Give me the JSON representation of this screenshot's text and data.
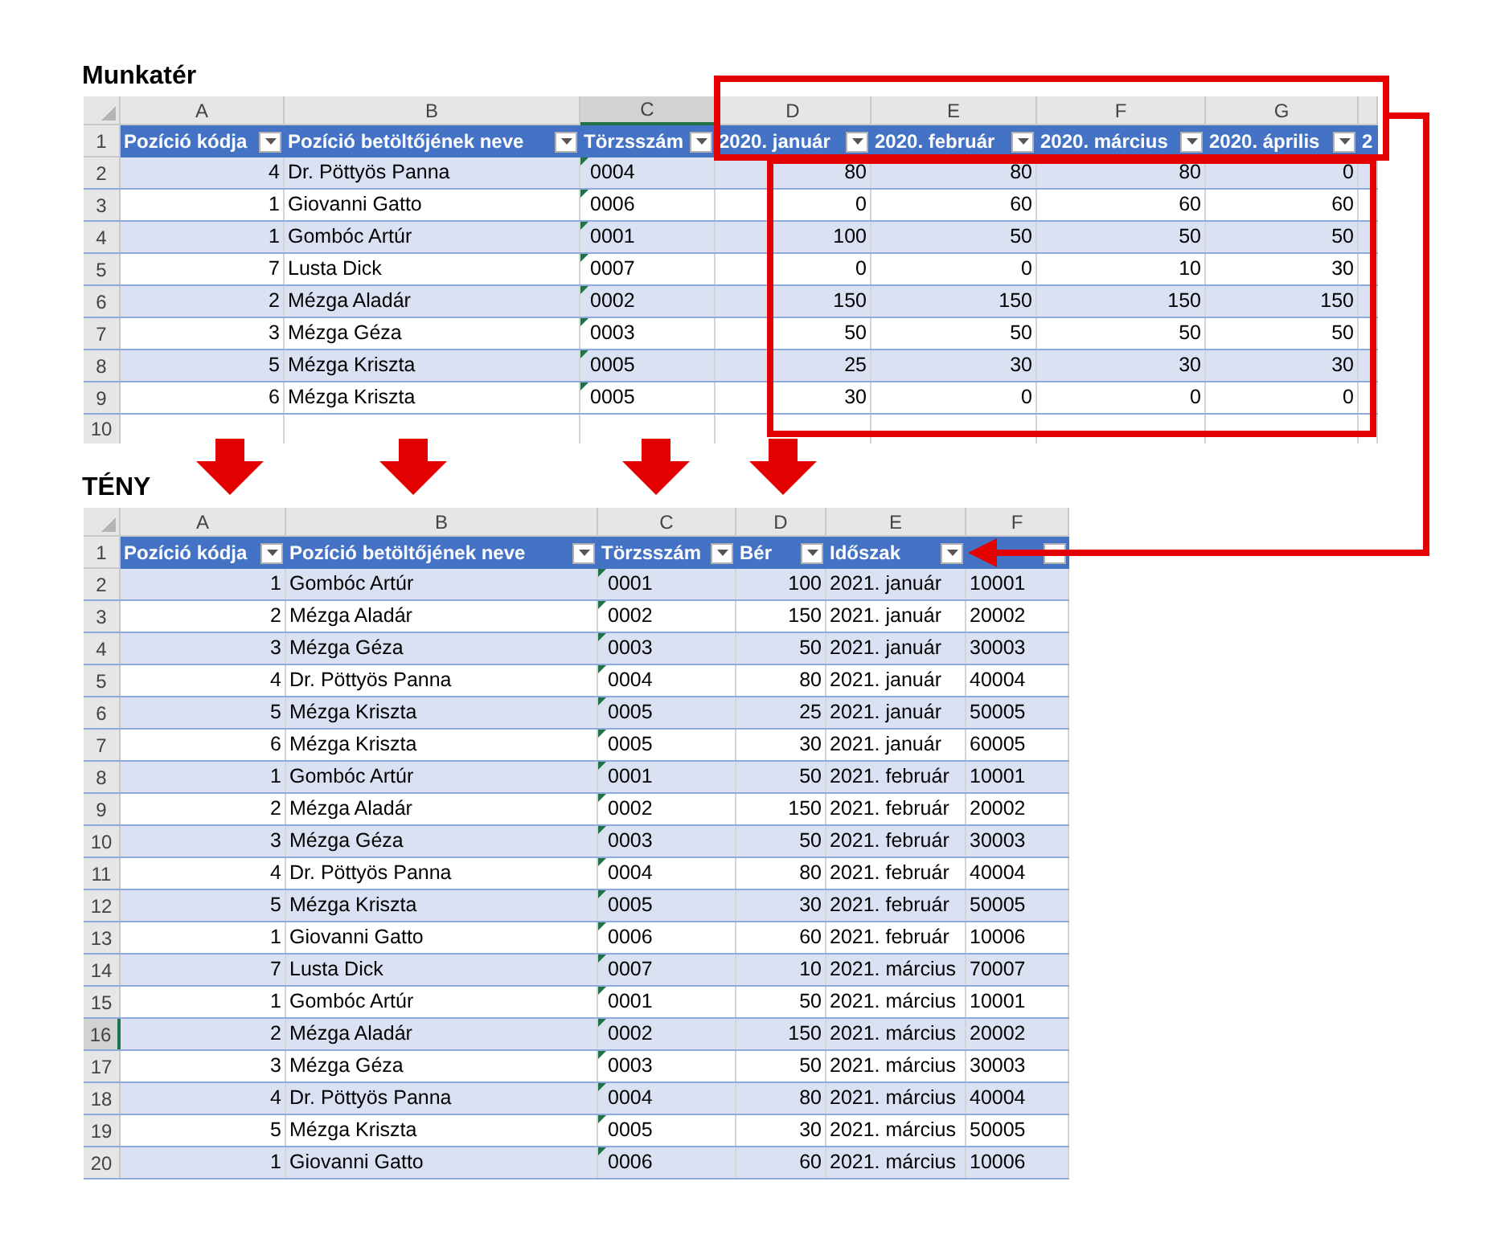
{
  "sheets": [
    {
      "title": "Munkatér",
      "header_row_number": "1",
      "columns": [
        {
          "letter": "A",
          "label": "Pozíció kódja",
          "kind": "number",
          "selected": false
        },
        {
          "letter": "B",
          "label": "Pozíció betöltőjének neve",
          "kind": "text",
          "selected": false
        },
        {
          "letter": "C",
          "label": "Törzsszám",
          "kind": "code",
          "selected": true
        },
        {
          "letter": "D",
          "label": "2020. január",
          "kind": "number",
          "selected": false
        },
        {
          "letter": "E",
          "label": "2020. február",
          "kind": "number",
          "selected": false
        },
        {
          "letter": "F",
          "label": "2020. március",
          "kind": "number",
          "selected": false
        },
        {
          "letter": "G",
          "label": "2020. április",
          "kind": "number",
          "selected": false
        },
        {
          "label": "2",
          "kind": "number",
          "selected": false
        }
      ],
      "rows": [
        {
          "number": "2",
          "selected": false,
          "cells": [
            "4",
            "Dr. Pöttyös Panna",
            "0004",
            "80",
            "80",
            "80",
            "0"
          ]
        },
        {
          "number": "3",
          "selected": false,
          "cells": [
            "1",
            "Giovanni Gatto",
            "0006",
            "0",
            "60",
            "60",
            "60"
          ]
        },
        {
          "number": "4",
          "selected": false,
          "cells": [
            "1",
            "Gombóc Artúr",
            "0001",
            "100",
            "50",
            "50",
            "50"
          ]
        },
        {
          "number": "5",
          "selected": false,
          "cells": [
            "7",
            "Lusta Dick",
            "0007",
            "0",
            "0",
            "10",
            "30"
          ]
        },
        {
          "number": "6",
          "selected": false,
          "cells": [
            "2",
            "Mézga Aladár",
            "0002",
            "150",
            "150",
            "150",
            "150"
          ]
        },
        {
          "number": "7",
          "selected": false,
          "cells": [
            "3",
            "Mézga Géza",
            "0003",
            "50",
            "50",
            "50",
            "50"
          ]
        },
        {
          "number": "8",
          "selected": false,
          "cells": [
            "5",
            "Mézga Kriszta",
            "0005",
            "25",
            "30",
            "30",
            "30"
          ]
        },
        {
          "number": "9",
          "selected": false,
          "cells": [
            "6",
            "Mézga Kriszta",
            "0005",
            "30",
            "0",
            "0",
            "0"
          ]
        }
      ],
      "empty_rows": [
        "10"
      ]
    },
    {
      "title": "TÉNY",
      "header_row_number": "1",
      "columns": [
        {
          "letter": "A",
          "label": "Pozíció kódja",
          "kind": "number",
          "selected": false
        },
        {
          "letter": "B",
          "label": "Pozíció betöltőjének neve",
          "kind": "text",
          "selected": false
        },
        {
          "letter": "C",
          "label": "Törzsszám",
          "kind": "code",
          "selected": false
        },
        {
          "letter": "D",
          "label": "Bér",
          "kind": "number",
          "selected": false
        },
        {
          "letter": "E",
          "label": "Időszak",
          "kind": "text",
          "selected": false
        },
        {
          "letter": "F",
          "kind": "text",
          "selected": false
        }
      ],
      "rows": [
        {
          "number": "2",
          "selected": false,
          "cells": [
            "1",
            "Gombóc Artúr",
            "0001",
            "100",
            "2021. január",
            "10001"
          ]
        },
        {
          "number": "3",
          "selected": false,
          "cells": [
            "2",
            "Mézga Aladár",
            "0002",
            "150",
            "2021. január",
            "20002"
          ]
        },
        {
          "number": "4",
          "selected": false,
          "cells": [
            "3",
            "Mézga Géza",
            "0003",
            "50",
            "2021. január",
            "30003"
          ]
        },
        {
          "number": "5",
          "selected": false,
          "cells": [
            "4",
            "Dr. Pöttyös Panna",
            "0004",
            "80",
            "2021. január",
            "40004"
          ]
        },
        {
          "number": "6",
          "selected": false,
          "cells": [
            "5",
            "Mézga Kriszta",
            "0005",
            "25",
            "2021. január",
            "50005"
          ]
        },
        {
          "number": "7",
          "selected": false,
          "cells": [
            "6",
            "Mézga Kriszta",
            "0005",
            "30",
            "2021. január",
            "60005"
          ]
        },
        {
          "number": "8",
          "selected": false,
          "cells": [
            "1",
            "Gombóc Artúr",
            "0001",
            "50",
            "2021. február",
            "10001"
          ]
        },
        {
          "number": "9",
          "selected": false,
          "cells": [
            "2",
            "Mézga Aladár",
            "0002",
            "150",
            "2021. február",
            "20002"
          ]
        },
        {
          "number": "10",
          "selected": false,
          "cells": [
            "3",
            "Mézga Géza",
            "0003",
            "50",
            "2021. február",
            "30003"
          ]
        },
        {
          "number": "11",
          "selected": false,
          "cells": [
            "4",
            "Dr. Pöttyös Panna",
            "0004",
            "80",
            "2021. február",
            "40004"
          ]
        },
        {
          "number": "12",
          "selected": false,
          "cells": [
            "5",
            "Mézga Kriszta",
            "0005",
            "30",
            "2021. február",
            "50005"
          ]
        },
        {
          "number": "13",
          "selected": false,
          "cells": [
            "1",
            "Giovanni Gatto",
            "0006",
            "60",
            "2021. február",
            "10006"
          ]
        },
        {
          "number": "14",
          "selected": false,
          "cells": [
            "7",
            "Lusta Dick",
            "0007",
            "10",
            "2021. március",
            "70007"
          ]
        },
        {
          "number": "15",
          "selected": false,
          "cells": [
            "1",
            "Gombóc Artúr",
            "0001",
            "50",
            "2021. március",
            "10001"
          ]
        },
        {
          "number": "16",
          "selected": true,
          "cells": [
            "2",
            "Mézga Aladár",
            "0002",
            "150",
            "2021. március",
            "20002"
          ]
        },
        {
          "number": "17",
          "selected": false,
          "cells": [
            "3",
            "Mézga Géza",
            "0003",
            "50",
            "2021. március",
            "30003"
          ]
        },
        {
          "number": "18",
          "selected": false,
          "cells": [
            "4",
            "Dr. Pöttyös Panna",
            "0004",
            "80",
            "2021. március",
            "40004"
          ]
        },
        {
          "number": "19",
          "selected": false,
          "cells": [
            "5",
            "Mézga Kriszta",
            "0005",
            "30",
            "2021. március",
            "50005"
          ]
        },
        {
          "number": "20",
          "selected": false,
          "cells": [
            "1",
            "Giovanni Gatto",
            "0006",
            "60",
            "2021. március",
            "10006"
          ]
        }
      ]
    }
  ]
}
